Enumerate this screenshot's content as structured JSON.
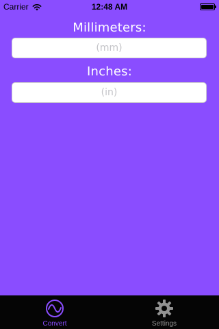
{
  "status_bar": {
    "carrier": "Carrier",
    "time": "12:48 AM"
  },
  "millimeters": {
    "label": "Millimeters:",
    "value": "",
    "placeholder": "(mm)"
  },
  "inches": {
    "label": "Inches:",
    "value": "",
    "placeholder": "(in)"
  },
  "tab_bar": {
    "tabs": [
      {
        "label": "Convert",
        "icon": "wave-icon",
        "selected": true,
        "color": "#8a4dff"
      },
      {
        "label": "Settings",
        "icon": "gear-icon",
        "selected": false,
        "color": "#929292"
      }
    ]
  },
  "colors": {
    "background": "#8a4dff",
    "tab_bar_bg": "#050505",
    "tab_selected": "#8a4dff",
    "tab_unselected": "#929292"
  }
}
